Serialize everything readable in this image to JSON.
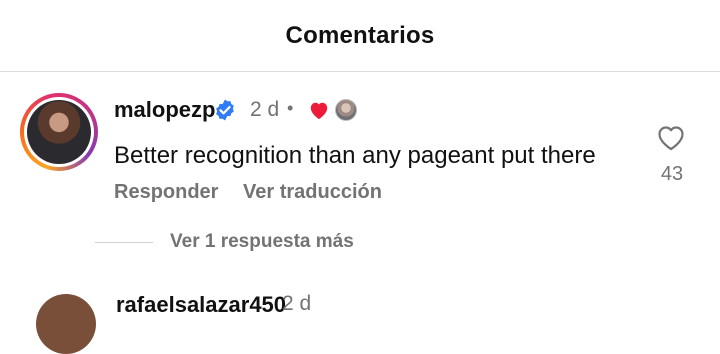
{
  "header": {
    "title": "Comentarios"
  },
  "comment": {
    "username": "malopezp",
    "verified": true,
    "time": "2 d",
    "separator": "•",
    "reaction_icon": "heart-red-icon",
    "text": "Better recognition than any pageant put there",
    "reply_label": "Responder",
    "translate_label": "Ver traducción",
    "like_count": "43",
    "view_replies_label": "Ver 1 respuesta más"
  },
  "next_comment": {
    "username": "rafaelsalazar450",
    "time": "2 d"
  },
  "colors": {
    "verified_blue": "#2f7cf6",
    "like_red": "#ed1c3a",
    "muted_text": "#737373"
  }
}
